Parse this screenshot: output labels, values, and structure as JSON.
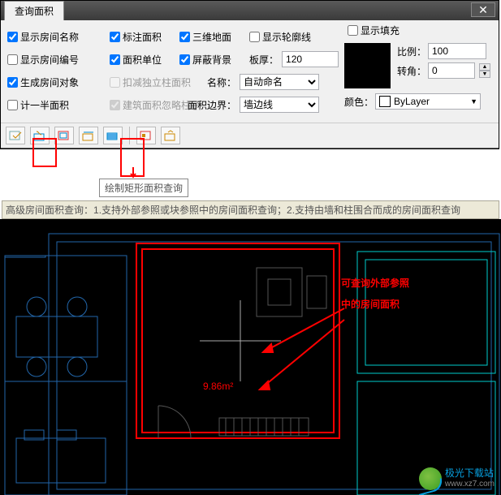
{
  "title": "查询面积",
  "checks": {
    "showName": {
      "label": "显示房间名称",
      "checked": true
    },
    "markArea": {
      "label": "标注面积",
      "checked": true
    },
    "threeD": {
      "label": "三维地面",
      "checked": true
    },
    "showContour": {
      "label": "显示轮廓线",
      "checked": false
    },
    "showFill": {
      "label": "显示填充",
      "checked": false
    },
    "showNo": {
      "label": "显示房间编号",
      "checked": false
    },
    "areaUnit": {
      "label": "面积单位",
      "checked": true
    },
    "shieldBg": {
      "label": "屏蔽背景",
      "checked": true
    },
    "genRoomObj": {
      "label": "生成房间对象",
      "checked": true
    },
    "subColumn": {
      "label": "扣减独立柱面积",
      "checked": false
    },
    "halfArea": {
      "label": "计一半面积",
      "checked": false
    },
    "ignorePillar": {
      "label": "建筑面积忽略柱子",
      "checked": true
    }
  },
  "fields": {
    "thickLabel": "板厚：",
    "thick": "120",
    "nameLabel": "名称：",
    "name": "自动命名",
    "areaBoundLabel": "面积边界：",
    "areaBound": "墙边线",
    "ratioLabel": "比例：",
    "ratio": "100",
    "rotLabel": "转角：",
    "rot": "0",
    "colorLabel": "颜色：",
    "color": "ByLayer"
  },
  "tooltip": "绘制矩形面积查询",
  "explain": {
    "prefix": "高级房间面积查询：",
    "p1": "1.支持外部参照或块参照中的房间面积查询；",
    "p2": "2.支持由墙和柱围合而成的房间面积查询"
  },
  "cad": {
    "area": "9.86m²",
    "annot1": "可查询外部参照",
    "annot2": "中的房间面积"
  },
  "logo": {
    "name": "极光下载站",
    "url": "www.xz7.com"
  }
}
